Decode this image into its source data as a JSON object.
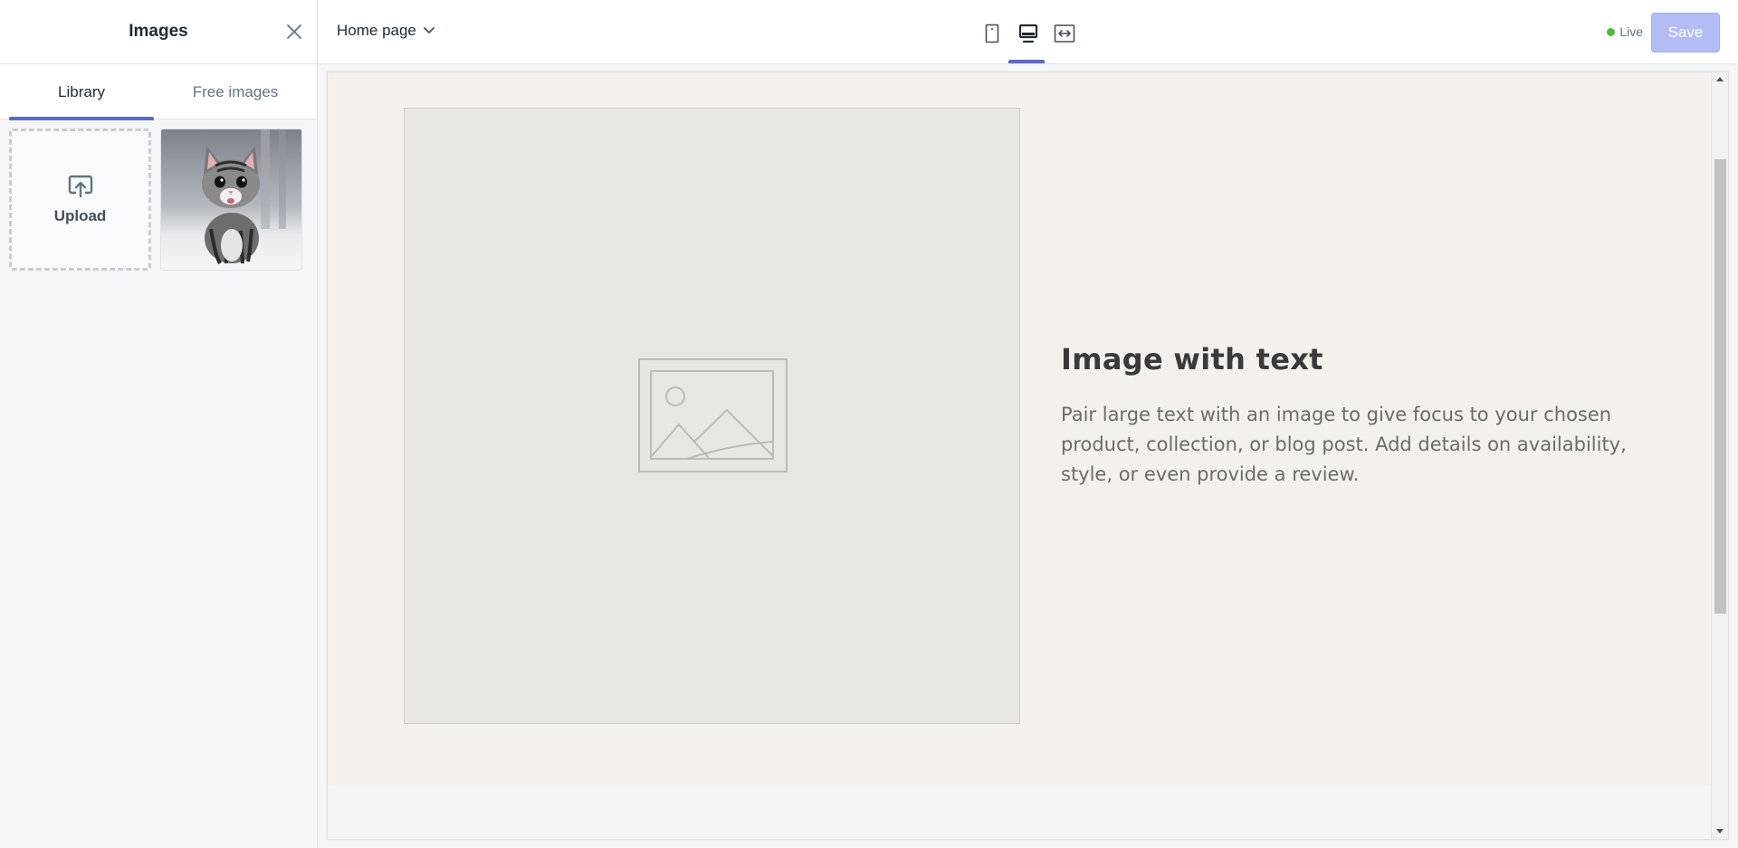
{
  "sidebar": {
    "title": "Images",
    "tabs": [
      {
        "label": "Library",
        "active": true
      },
      {
        "label": "Free images",
        "active": false
      }
    ],
    "upload_label": "Upload",
    "images": [
      {
        "icon": "kitten-photo"
      }
    ]
  },
  "topbar": {
    "page_selector": "Home page",
    "devices": [
      {
        "icon": "mobile-icon",
        "active": false
      },
      {
        "icon": "desktop-icon",
        "active": true
      },
      {
        "icon": "fullwidth-icon",
        "active": false
      }
    ],
    "status": "Live",
    "save_label": "Save"
  },
  "preview": {
    "section_heading": "Image with text",
    "section_text": "Pair large text with an image to give focus to your chosen product, collection, or blog post. Add details on availability, style, or even provide a review."
  },
  "colors": {
    "accent": "#5c6ac4",
    "save_disabled": "#b3bcf5",
    "live": "#50b83c",
    "preview_bg": "#f4f1ec"
  }
}
